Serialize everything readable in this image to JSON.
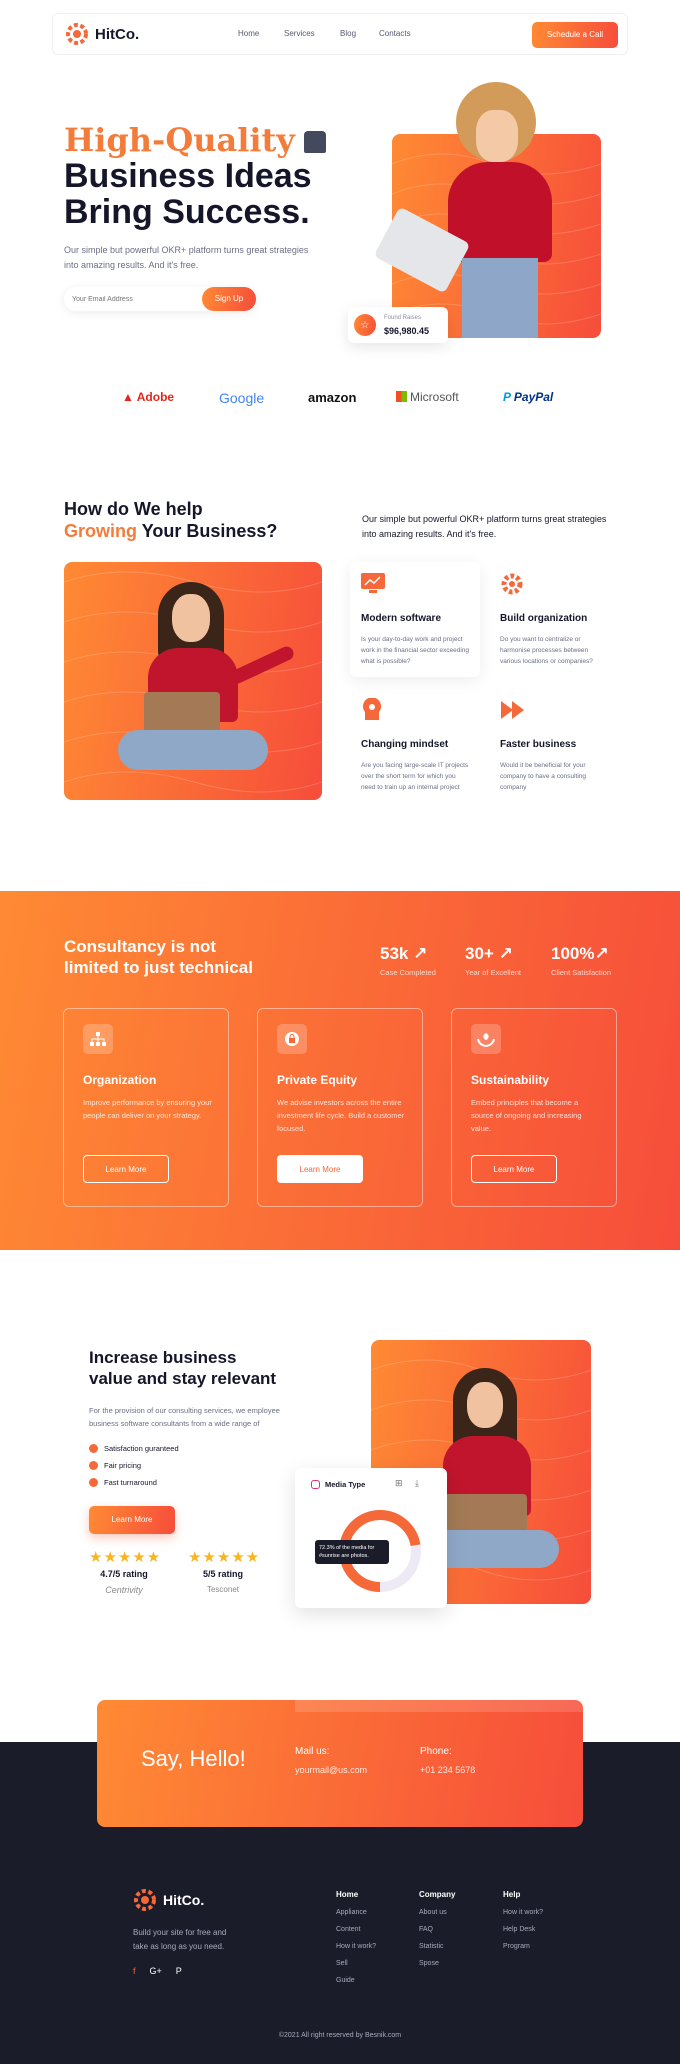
{
  "brand": {
    "name": "HitCo."
  },
  "nav": {
    "items": [
      "Home",
      "Services",
      "Blog",
      "Contacts"
    ],
    "cta": "Schedule a Call"
  },
  "hero": {
    "title_highlight": "High-Quality",
    "title_line2": "Business Ideas",
    "title_line3": "Bring Success.",
    "subtitle": "Our simple but powerful OKR+ platform turns great strategies into amazing results. And it's free.",
    "email_placeholder": "Your Email Address",
    "signup_label": "Sign Up",
    "found_label": "Found Raises",
    "found_value": "$96,980.45"
  },
  "logos": [
    "Adobe",
    "Google",
    "amazon",
    "Microsoft",
    "PayPal"
  ],
  "help": {
    "title_line1": "How do We help",
    "title_highlight": "Growing",
    "title_rest": "Your Business?",
    "description": "Our simple but powerful OKR+ platform turns great strategies into amazing results. And it's free.",
    "features": [
      {
        "title": "Modern software",
        "text": "Is your day-to-day work and project work in the financial sector exceeding what is possible?"
      },
      {
        "title": "Build organization",
        "text": "Do you want to centralize or harmonise processes between various locations or companies?"
      },
      {
        "title": "Changing mindset",
        "text": "Are you facing large-scale IT projects over the short term for which you need to train up an internal project"
      },
      {
        "title": "Faster business",
        "text": "Would it be beneficial for your company to have a consulting company"
      }
    ]
  },
  "consult": {
    "title_line1": "Consultancy is not",
    "title_line2": "limited to just technical",
    "stats": [
      {
        "value": "53k",
        "label": "Case Completed"
      },
      {
        "value": "30+",
        "label": "Year of Excellent"
      },
      {
        "value": "100%",
        "label": "Client Satisfaction"
      }
    ],
    "cards": [
      {
        "title": "Organization",
        "text": "Improve performance by ensuring your people can deliver on your strategy.",
        "button": "Learn More"
      },
      {
        "title": "Private Equity",
        "text": "We advise investors across the entire investment life cycle. Build a customer focused.",
        "button": "Learn More"
      },
      {
        "title": "Sustainability",
        "text": "Embed principles that become a source of ongoing and increasing value.",
        "button": "Learn More"
      }
    ]
  },
  "value": {
    "title_line1": "Increase business",
    "title_line2": "value and stay relevant",
    "text": "For the provision of our consulting services, we employee business software consultants from a wide range of",
    "checks": [
      "Satisfaction guranteed",
      "Fair pricing",
      "Fast turnaround"
    ],
    "button": "Learn More",
    "ratings": [
      {
        "stars": "★★★★★",
        "label": "4.7/5 rating",
        "brand": "Centrivity"
      },
      {
        "stars": "★★★★★",
        "label": "5/5 rating",
        "brand": "Tesconet"
      }
    ],
    "media_title": "Media Type",
    "tooltip": "72.3% of the media for #sunrise are photos.",
    "donut_fraction": 0.723
  },
  "contact": {
    "hello": "Say, Hello!",
    "mail_label": "Mail us:",
    "mail_value": "yourmail@us.com",
    "phone_label": "Phone:",
    "phone_value": "+01 234 5678"
  },
  "footer": {
    "tagline_1": "Build your site for free and",
    "tagline_2": "take as long as you need.",
    "cols": [
      {
        "title": "Home",
        "links": [
          "Appliance",
          "Content",
          "How it work?",
          "Sell",
          "Guide"
        ]
      },
      {
        "title": "Company",
        "links": [
          "About us",
          "FAQ",
          "Statistic",
          "Spose"
        ]
      },
      {
        "title": "Help",
        "links": [
          "How it work?",
          "Help Desk",
          "Program"
        ]
      }
    ],
    "copyright": "©2021 All right reserved by Besnik.com"
  },
  "colors": {
    "accent": "#f4683a",
    "orange": "#ff8a34",
    "red": "#f64d3a",
    "dark": "#1b1c2a"
  }
}
